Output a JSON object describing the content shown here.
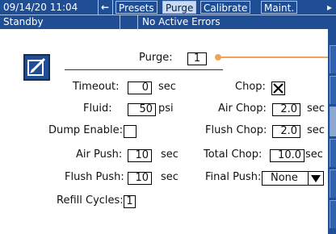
{
  "topbar": {
    "datetime": "09/14/20 11:04",
    "back_glyph": "←",
    "tabs": [
      {
        "label": "Presets",
        "active": false
      },
      {
        "label": "Purge",
        "active": true
      },
      {
        "label": "Calibrate",
        "active": false
      },
      {
        "label": "Maint.",
        "active": false
      }
    ],
    "more_glyph": "▸"
  },
  "status": {
    "mode": "Standby",
    "errors": "No Active Errors"
  },
  "form": {
    "purge_label": "Purge:",
    "purge_value": "1",
    "timeout_label": "Timeout:",
    "timeout_value": "0",
    "timeout_unit": "sec",
    "fluid_label": "Fluid:",
    "fluid_value": "50",
    "fluid_unit": "psi",
    "dump_enable_label": "Dump Enable:",
    "air_push_label": "Air Push:",
    "air_push_value": "10",
    "air_push_unit": "sec",
    "flush_push_label": "Flush Push:",
    "flush_push_value": "10",
    "flush_push_unit": "sec",
    "refill_cycles_label": "Refill Cycles:",
    "refill_cycles_value": "1",
    "chop_label": "Chop:",
    "chop_checked": true,
    "air_chop_label": "Air Chop:",
    "air_chop_value": "2.0",
    "air_chop_unit": "sec",
    "flush_chop_label": "Flush Chop:",
    "flush_chop_value": "2.0",
    "flush_chop_unit": "sec",
    "total_chop_label": "Total Chop:",
    "total_chop_value": "10.0",
    "total_chop_unit": "sec",
    "final_push_label": "Final Push:",
    "final_push_value": "None"
  },
  "colors": {
    "header_blue": "#1f4e94",
    "tab_active_bg": "#c8d9f3",
    "slider_orange": "#f0a35a"
  }
}
